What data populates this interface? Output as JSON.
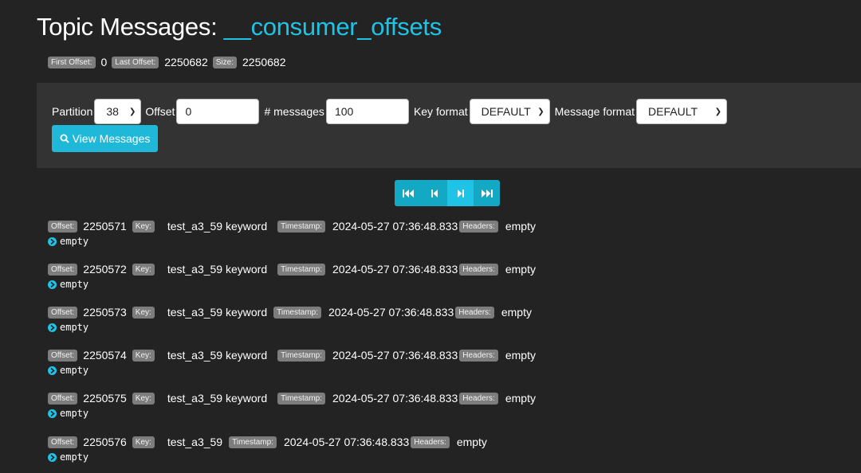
{
  "header": {
    "title_prefix": "Topic Messages: ",
    "topic_name": "__consumer_offsets"
  },
  "meta": {
    "first_offset_label": "First Offset:",
    "first_offset_value": "0",
    "last_offset_label": "Last Offset:",
    "last_offset_value": "2250682",
    "size_label": "Size:",
    "size_value": "2250682"
  },
  "form": {
    "partition_label": "Partition",
    "partition_value": "38",
    "offset_label": "Offset",
    "offset_value": "0",
    "messages_label": "# messages",
    "messages_value": "100",
    "key_format_label": "Key format",
    "key_format_value": "DEFAULT",
    "message_format_label": "Message format",
    "message_format_value": "DEFAULT",
    "view_button_label": "View Messages"
  },
  "labels": {
    "offset": "Offset:",
    "key": "Key:",
    "timestamp": "Timestamp:",
    "headers": "Headers:"
  },
  "messages": [
    {
      "offset": "2250571",
      "key": "test_a3_59 keyword",
      "timestamp": "2024-05-27 07:36:48.833",
      "headers": "empty",
      "body": "empty"
    },
    {
      "offset": "2250572",
      "key": "test_a3_59 keyword",
      "timestamp": "2024-05-27 07:36:48.833",
      "headers": "empty",
      "body": "empty"
    },
    {
      "offset": "2250573",
      "key": "test_a3_59 keyword",
      "timestamp": "2024-05-27 07:36:48.833",
      "headers": "empty",
      "body": "empty"
    },
    {
      "offset": "2250574",
      "key": "test_a3_59 keyword",
      "timestamp": "2024-05-27 07:36:48.833",
      "headers": "empty",
      "body": "empty"
    },
    {
      "offset": "2250575",
      "key": "test_a3_59 keyword",
      "timestamp": "2024-05-27 07:36:48.833",
      "headers": "empty",
      "body": "empty"
    },
    {
      "offset": "2250576",
      "key": "test_a3_59",
      "timestamp": "2024-05-27 07:36:48.833",
      "headers": "empty",
      "body": "empty"
    }
  ],
  "icons": {
    "search": "search-icon",
    "first": "first-page-icon",
    "prev": "prev-page-icon",
    "next": "next-page-icon",
    "last": "last-page-icon",
    "expand": "expand-icon"
  },
  "colors": {
    "accent": "#1fc3e6",
    "background": "#232323",
    "panel": "#333333",
    "badge": "#7d7d7d"
  }
}
